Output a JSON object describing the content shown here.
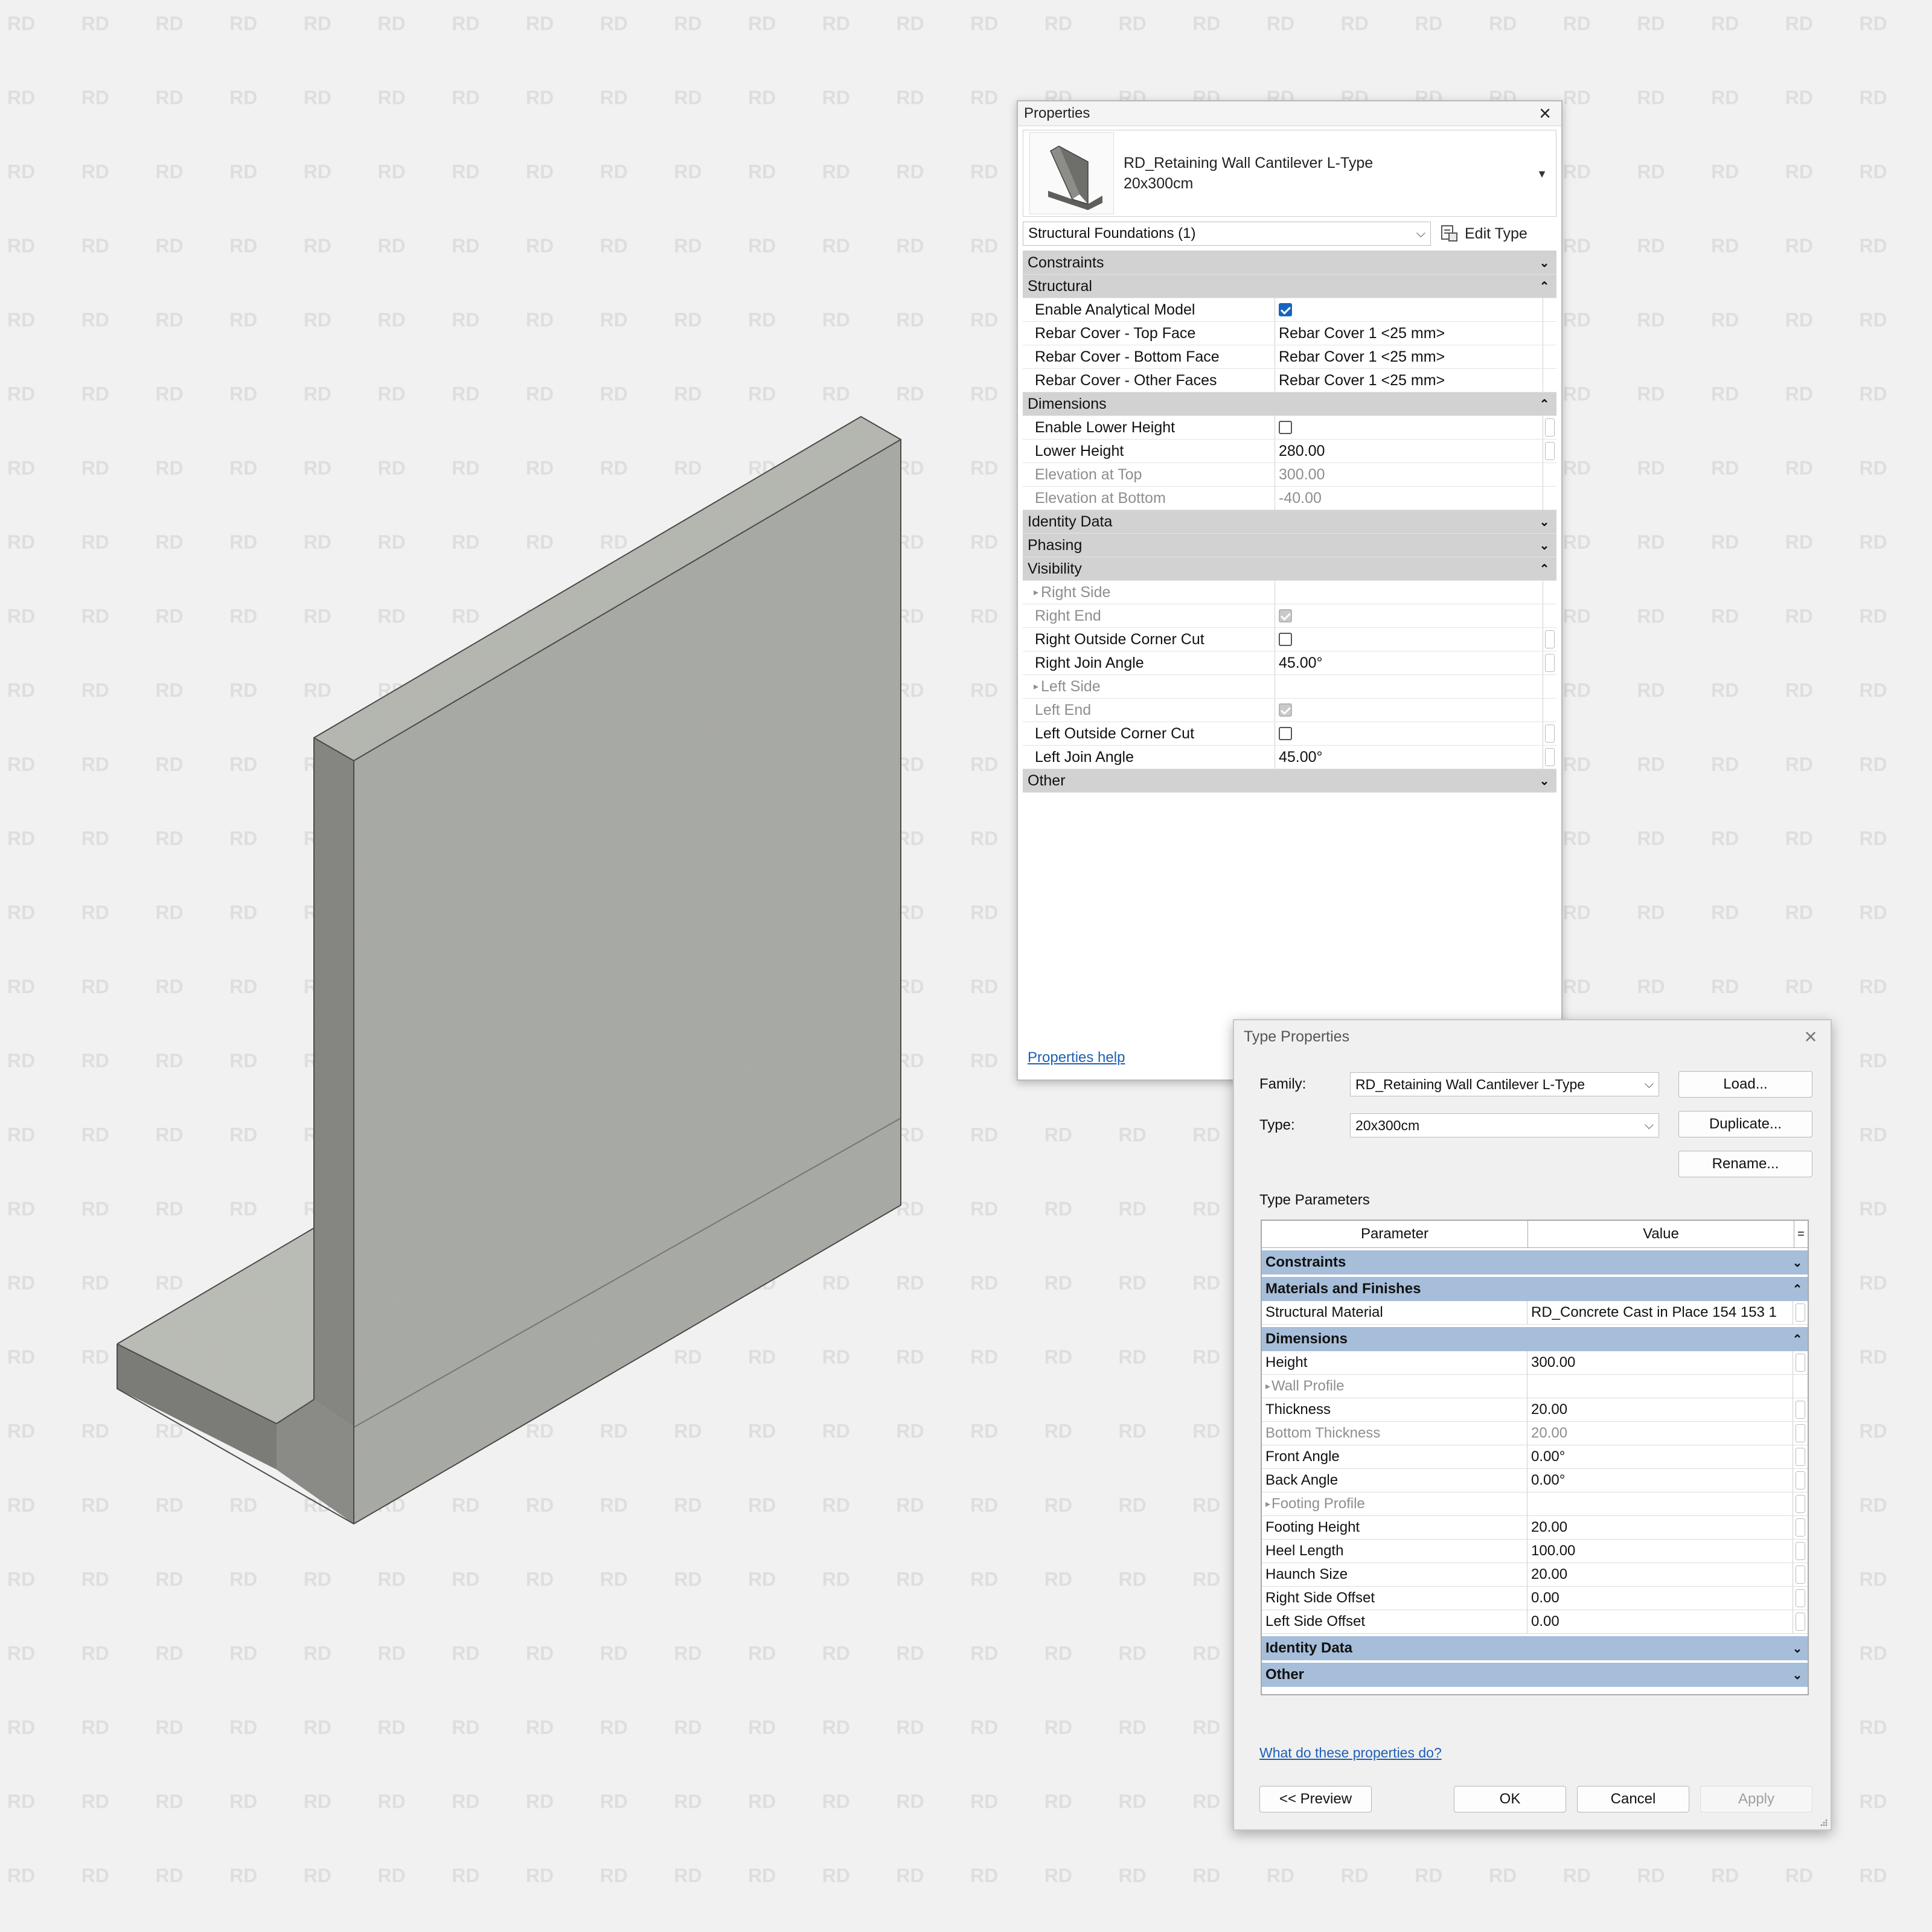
{
  "watermark_text": "RD",
  "properties": {
    "title": "Properties",
    "type_name": "RD_Retaining Wall Cantilever L-Type",
    "type_size": "20x300cm",
    "filter": "Structural Foundations (1)",
    "edit_type_label": "Edit Type",
    "help_label": "Properties help",
    "groups": {
      "constraints": "Constraints",
      "structural": "Structural",
      "dimensions": "Dimensions",
      "identity": "Identity Data",
      "phasing": "Phasing",
      "visibility": "Visibility",
      "other": "Other"
    },
    "structural": {
      "enable_analytical": "Enable Analytical Model",
      "rebar_top": "Rebar Cover - Top Face",
      "rebar_top_val": "Rebar Cover 1 <25 mm>",
      "rebar_bottom": "Rebar Cover - Bottom Face",
      "rebar_bottom_val": "Rebar Cover 1 <25 mm>",
      "rebar_other": "Rebar Cover - Other Faces",
      "rebar_other_val": "Rebar Cover 1 <25 mm>"
    },
    "dimensions": {
      "enable_lower": "Enable Lower Height",
      "lower_height": "Lower Height",
      "lower_height_val": "280.00",
      "elev_top": "Elevation at Top",
      "elev_top_val": "300.00",
      "elev_bottom": "Elevation at Bottom",
      "elev_bottom_val": "-40.00"
    },
    "visibility": {
      "right_side": "Right Side",
      "right_end": "Right End",
      "right_corner": "Right Outside Corner Cut",
      "right_angle": "Right Join Angle",
      "right_angle_val": "45.00°",
      "left_side": "Left Side",
      "left_end": "Left End",
      "left_corner": "Left Outside Corner Cut",
      "left_angle": "Left Join Angle",
      "left_angle_val": "45.00°"
    }
  },
  "type_dialog": {
    "title": "Type Properties",
    "family_label": "Family:",
    "family_value": "RD_Retaining Wall Cantilever L-Type",
    "type_label": "Type:",
    "type_value": "20x300cm",
    "load_btn": "Load...",
    "duplicate_btn": "Duplicate...",
    "rename_btn": "Rename...",
    "params_label": "Type Parameters",
    "col_param": "Parameter",
    "col_value": "Value",
    "col_eq": "=",
    "groups": {
      "constraints": "Constraints",
      "materials": "Materials and Finishes",
      "dimensions": "Dimensions",
      "identity": "Identity Data",
      "other": "Other"
    },
    "material_name": "Structural Material",
    "material_value": "RD_Concrete Cast in Place 154 153 1",
    "rows": [
      {
        "name": "Height",
        "value": "300.00"
      },
      {
        "name": "Wall Profile",
        "value": ""
      },
      {
        "name": "Thickness",
        "value": "20.00"
      },
      {
        "name": "Bottom Thickness",
        "value": "20.00"
      },
      {
        "name": "Front Angle",
        "value": "0.00°"
      },
      {
        "name": "Back Angle",
        "value": "0.00°"
      },
      {
        "name": "Footing Profile",
        "value": ""
      },
      {
        "name": "Footing Height",
        "value": "20.00"
      },
      {
        "name": "Heel Length",
        "value": "100.00"
      },
      {
        "name": "Haunch Size",
        "value": "20.00"
      },
      {
        "name": "Right Side Offset",
        "value": "0.00"
      },
      {
        "name": "Left Side Offset",
        "value": "0.00"
      }
    ],
    "help_link": "What do these properties do?",
    "preview_btn": "<< Preview",
    "ok_btn": "OK",
    "cancel_btn": "Cancel",
    "apply_btn": "Apply"
  }
}
